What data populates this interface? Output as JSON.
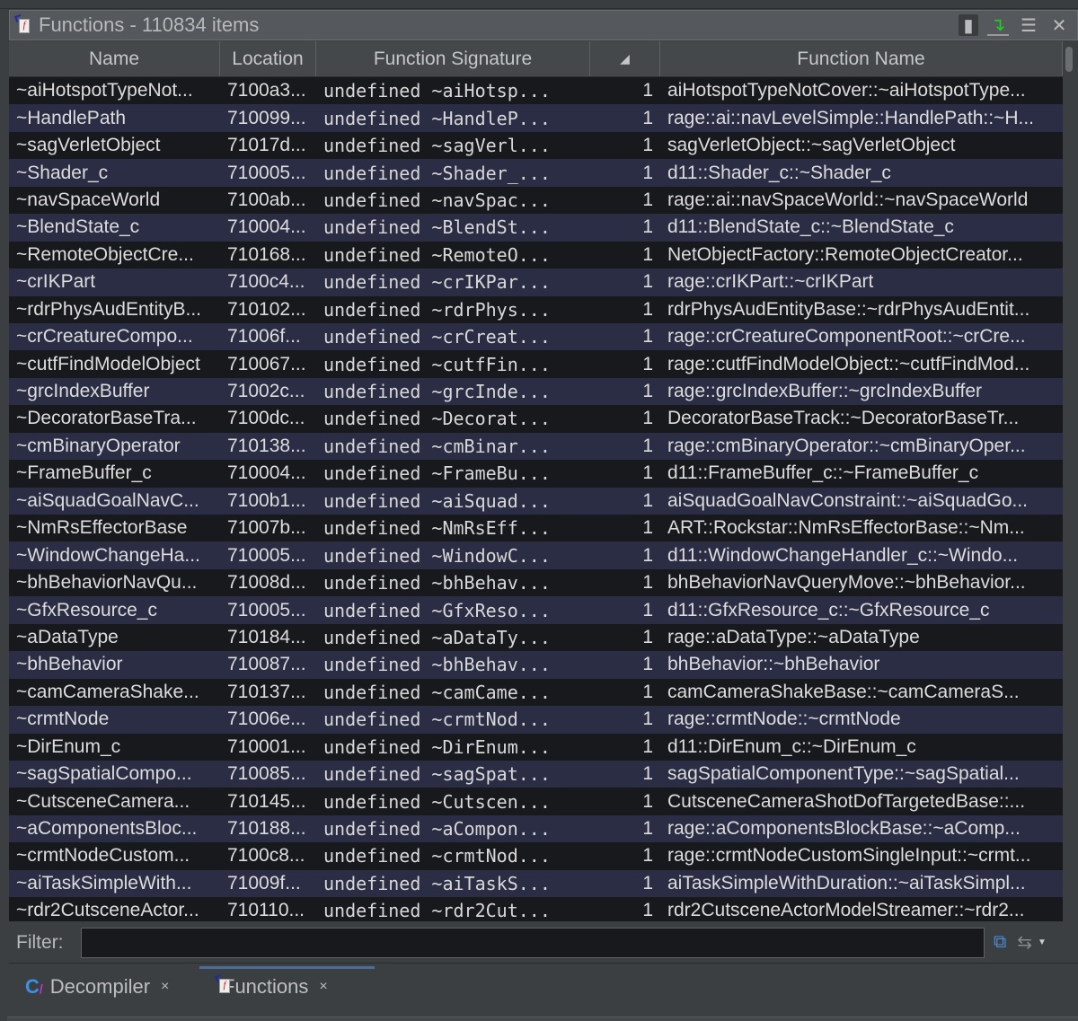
{
  "window": {
    "title": "Functions - 110834 items"
  },
  "columns": [
    "Name",
    "Location",
    "Function Signature",
    "",
    "Function Name"
  ],
  "rows": [
    [
      "~aiHotspotTypeNot...",
      "7100a3...",
      "undefined ~aiHotsp...",
      "1",
      "aiHotspotTypeNotCover::~aiHotspotType..."
    ],
    [
      "~HandlePath",
      "710099...",
      "undefined ~HandleP...",
      "1",
      "rage::ai::navLevelSimple::HandlePath::~H..."
    ],
    [
      "~sagVerletObject",
      "71017d...",
      "undefined ~sagVerl...",
      "1",
      "sagVerletObject::~sagVerletObject"
    ],
    [
      "~Shader_c",
      "710005...",
      "undefined ~Shader_...",
      "1",
      "d11::Shader_c::~Shader_c"
    ],
    [
      "~navSpaceWorld",
      "7100ab...",
      "undefined ~navSpac...",
      "1",
      "rage::ai::navSpaceWorld::~navSpaceWorld"
    ],
    [
      "~BlendState_c",
      "710004...",
      "undefined ~BlendSt...",
      "1",
      "d11::BlendState_c::~BlendState_c"
    ],
    [
      "~RemoteObjectCre...",
      "710168...",
      "undefined ~RemoteO...",
      "1",
      "NetObjectFactory::RemoteObjectCreator..."
    ],
    [
      "~crIKPart",
      "7100c4...",
      "undefined ~crIKPar...",
      "1",
      "rage::crIKPart::~crIKPart"
    ],
    [
      "~rdrPhysAudEntityB...",
      "710102...",
      "undefined ~rdrPhys...",
      "1",
      "rdrPhysAudEntityBase::~rdrPhysAudEntit..."
    ],
    [
      "~crCreatureCompo...",
      "71006f...",
      "undefined ~crCreat...",
      "1",
      "rage::crCreatureComponentRoot::~crCre..."
    ],
    [
      "~cutfFindModelObject",
      "710067...",
      "undefined ~cutfFin...",
      "1",
      "rage::cutfFindModelObject::~cutfFindMod..."
    ],
    [
      "~grcIndexBuffer",
      "71002c...",
      "undefined ~grcInde...",
      "1",
      "rage::grcIndexBuffer::~grcIndexBuffer"
    ],
    [
      "~DecoratorBaseTra...",
      "7100dc...",
      "undefined ~Decorat...",
      "1",
      "DecoratorBaseTrack::~DecoratorBaseTr..."
    ],
    [
      "~cmBinaryOperator",
      "710138...",
      "undefined ~cmBinar...",
      "1",
      "rage::cmBinaryOperator::~cmBinaryOper..."
    ],
    [
      "~FrameBuffer_c",
      "710004...",
      "undefined ~FrameBu...",
      "1",
      "d11::FrameBuffer_c::~FrameBuffer_c"
    ],
    [
      "~aiSquadGoalNavC...",
      "7100b1...",
      "undefined ~aiSquad...",
      "1",
      "aiSquadGoalNavConstraint::~aiSquadGo..."
    ],
    [
      "~NmRsEffectorBase",
      "71007b...",
      "undefined ~NmRsEff...",
      "1",
      "ART::Rockstar::NmRsEffectorBase::~Nm..."
    ],
    [
      "~WindowChangeHa...",
      "710005...",
      "undefined ~WindowC...",
      "1",
      "d11::WindowChangeHandler_c::~Windo..."
    ],
    [
      "~bhBehaviorNavQu...",
      "71008d...",
      "undefined ~bhBehav...",
      "1",
      "bhBehaviorNavQueryMove::~bhBehavior..."
    ],
    [
      "~GfxResource_c",
      "710005...",
      "undefined ~GfxReso...",
      "1",
      "d11::GfxResource_c::~GfxResource_c"
    ],
    [
      "~aDataType",
      "710184...",
      "undefined ~aDataTy...",
      "1",
      "rage::aDataType::~aDataType"
    ],
    [
      "~bhBehavior",
      "710087...",
      "undefined ~bhBehav...",
      "1",
      "bhBehavior::~bhBehavior"
    ],
    [
      "~camCameraShake...",
      "710137...",
      "undefined ~camCame...",
      "1",
      "camCameraShakeBase::~camCameraS..."
    ],
    [
      "~crmtNode",
      "71006e...",
      "undefined ~crmtNod...",
      "1",
      "rage::crmtNode::~crmtNode"
    ],
    [
      "~DirEnum_c",
      "710001...",
      "undefined ~DirEnum...",
      "1",
      "d11::DirEnum_c::~DirEnum_c"
    ],
    [
      "~sagSpatialCompo...",
      "710085...",
      "undefined ~sagSpat...",
      "1",
      "sagSpatialComponentType::~sagSpatial..."
    ],
    [
      "~CutsceneCamera...",
      "710145...",
      "undefined ~Cutscen...",
      "1",
      "CutsceneCameraShotDofTargetedBase::..."
    ],
    [
      "~aComponentsBloc...",
      "710188...",
      "undefined ~aCompon...",
      "1",
      "rage::aComponentsBlockBase::~aComp..."
    ],
    [
      "~crmtNodeCustom...",
      "7100c8...",
      "undefined ~crmtNod...",
      "1",
      "rage::crmtNodeCustomSingleInput::~crmt..."
    ],
    [
      "~aiTaskSimpleWith...",
      "71009f...",
      "undefined ~aiTaskS...",
      "1",
      "aiTaskSimpleWithDuration::~aiTaskSimpl..."
    ],
    [
      "~rdr2CutsceneActor...",
      "710110...",
      "undefined ~rdr2Cut...",
      "1",
      "rdr2CutsceneActorModelStreamer::~rdr2..."
    ]
  ],
  "filter": {
    "label": "Filter:",
    "value": ""
  },
  "tabs": [
    {
      "label": "Decompiler",
      "close": "×"
    },
    {
      "label": "Functions",
      "close": "×"
    }
  ]
}
